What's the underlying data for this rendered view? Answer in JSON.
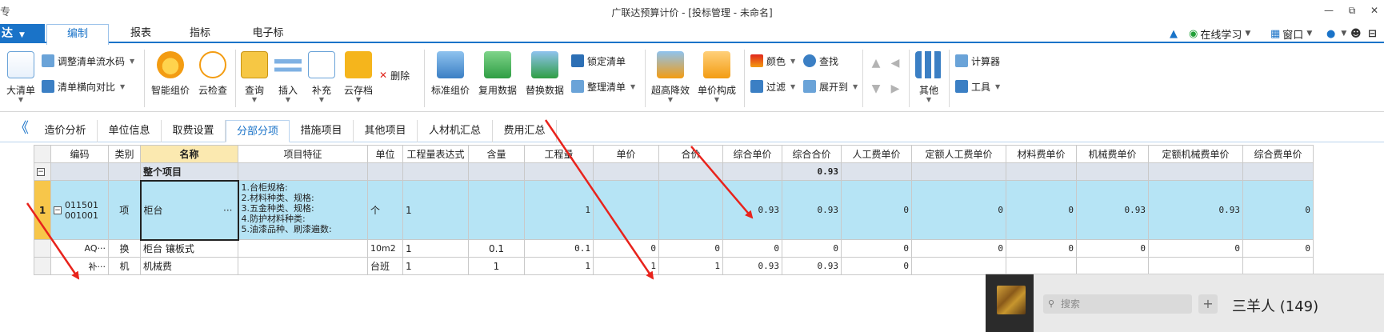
{
  "window": {
    "title": "广联达预算计价 - [投标管理 - 未命名]",
    "left_glyph": "专",
    "min_glyph": "—",
    "max_glyph": "⧉",
    "close_glyph": "✕"
  },
  "menubar": {
    "logo": "达",
    "tabs": [
      "编制",
      "报表",
      "指标",
      "电子标"
    ],
    "right": {
      "learn": "在线学习",
      "window": "窗口",
      "user_glyph": "●",
      "help_glyph": "☻",
      "expand_glyph": "▲",
      "more_glyph": "⊟"
    }
  },
  "ribbon": {
    "big_list": "大清单",
    "adjust_code": "调整清单流水码",
    "horizontal_compare": "清单横向对比",
    "smart_price": "智能组价",
    "cloud_check": "云检查",
    "query": "查询",
    "insert": "插入",
    "supplement": "补充",
    "cloud_save": "云存档",
    "delete": "删除",
    "standard_price": "标准组价",
    "reuse_data": "复用数据",
    "replace_data": "替换数据",
    "lock_list": "锁定清单",
    "tidy_list": "整理清单",
    "super_height": "超高降效",
    "unit_price_make": "单价构成",
    "color": "颜色",
    "find": "查找",
    "filter": "过滤",
    "expand_to": "展开到",
    "other": "其他",
    "calculator": "计算器",
    "tools": "工具"
  },
  "sheet_tabs": [
    "造价分析",
    "单位信息",
    "取费设置",
    "分部分项",
    "措施项目",
    "其他项目",
    "人材机汇总",
    "费用汇总"
  ],
  "sheet_tabs_active": "分部分项",
  "collapse_glyph": "《",
  "grid": {
    "headers": [
      "编码",
      "类别",
      "名称",
      "项目特征",
      "单位",
      "工程量表达式",
      "含量",
      "工程量",
      "单价",
      "合价",
      "综合单价",
      "综合合价",
      "人工费单价",
      "定额人工费单价",
      "材料费单价",
      "机械费单价",
      "定额机械费单价",
      "综合费单价"
    ],
    "group": {
      "name": "整个项目",
      "total": "0.93",
      "toggle": "−"
    },
    "main_row": {
      "num": "1",
      "toggle": "−",
      "code_line1": "011501",
      "code_line2": "001001",
      "type": "项",
      "name": "柜台",
      "name_ellipsis": "···",
      "features": [
        "1.台柜规格:",
        "2.材料种类、规格:",
        "3.五金种类、规格:",
        "4.防护材料种类:",
        "5.油漆品种、刷漆遍数:"
      ],
      "unit": "个",
      "expr": "1",
      "qty": "1",
      "zhdj": "0.93",
      "zhhj": "0.93",
      "rgf": "0",
      "derg": "0",
      "clf": "0",
      "jxf": "0.93",
      "dejx": "0.93",
      "zhf": "0"
    },
    "sub_rows": [
      {
        "code": "AQ···",
        "type": "换",
        "name": "柜台 镶板式",
        "unit": "10m2",
        "expr": "1",
        "hl": "0.1",
        "qty": "0.1",
        "dj": "0",
        "hj": "0",
        "zhdj": "0",
        "zhhj": "0",
        "rgf": "0",
        "derg": "0",
        "clf": "0",
        "jxf": "0",
        "dejx": "0",
        "zhf": "0"
      },
      {
        "code": "补···",
        "type": "机",
        "name": "机械费",
        "unit": "台班",
        "expr": "1",
        "hl": "1",
        "qty": "1",
        "dj": "1",
        "hj": "1",
        "zhdj": "0.93",
        "zhhj": "0.93",
        "rgf": "0"
      }
    ]
  },
  "chat": {
    "search_placeholder": "搜索",
    "search_glyph": "⚲",
    "plus": "+",
    "name": "三羊人 (149)"
  },
  "colors": {
    "accent": "#1a73c8",
    "selected_row": "#b6e4f5",
    "name_header": "#fbe9b0",
    "group_row": "#dde3ec",
    "arrow": "#e8231c"
  }
}
